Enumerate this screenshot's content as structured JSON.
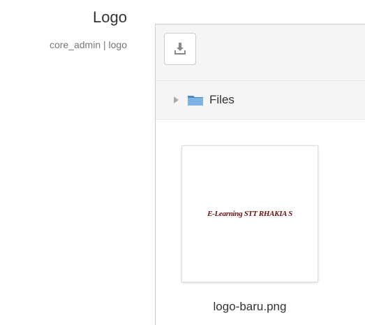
{
  "setting": {
    "title": "Logo",
    "subtitle": "core_admin | logo"
  },
  "filemanager": {
    "toolbar": {
      "download_icon": "download-icon"
    },
    "path": {
      "folder_icon": "folder-icon",
      "label": "Files"
    },
    "files": [
      {
        "name": "logo-baru.png",
        "preview_text": "E-Learning STT RHAKIA S"
      }
    ]
  },
  "colors": {
    "toolbar_bg": "#f5f5f5",
    "border": "#cccccc",
    "folder_blue": "#5b9bd5",
    "logo_text": "#6b1010"
  }
}
